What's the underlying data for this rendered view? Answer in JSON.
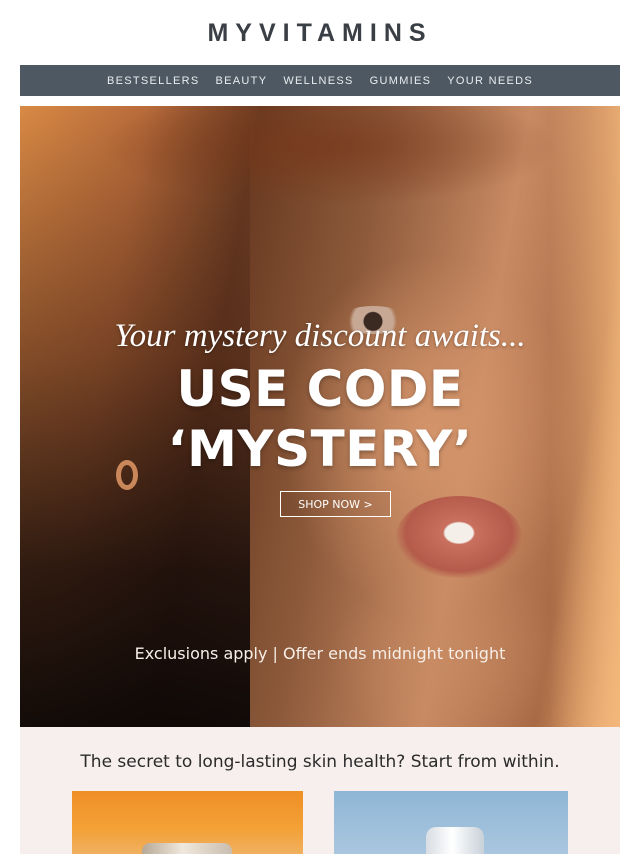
{
  "brand": {
    "logo_text": "MYVITAMINS"
  },
  "nav": {
    "items": [
      {
        "label": "BESTSELLERS"
      },
      {
        "label": "BEAUTY"
      },
      {
        "label": "WELLNESS"
      },
      {
        "label": "GUMMIES"
      },
      {
        "label": "YOUR NEEDS"
      }
    ]
  },
  "hero": {
    "tagline": "Your mystery discount awaits...",
    "code_line_1": "USE CODE",
    "code_line_2": "‘MYSTERY’",
    "cta_label": "SHOP NOW >",
    "exclusions": "Exclusions apply | Offer ends midnight tonight"
  },
  "promo": {
    "title": "The secret to long-lasting skin health? Start from within."
  },
  "colors": {
    "nav_background": "#4d5862",
    "logo": "#3a3f45",
    "promo_background": "#f6efed"
  }
}
